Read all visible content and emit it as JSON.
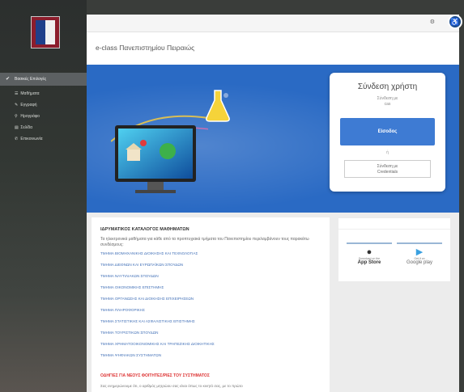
{
  "sidebar": {
    "header": "Βασικές Επιλογές",
    "items": [
      {
        "label": "Μαθήματα",
        "icon": "list-icon"
      },
      {
        "label": "Εγγραφή",
        "icon": "edit-icon"
      },
      {
        "label": "Ηρογράφο",
        "icon": "search-icon"
      },
      {
        "label": "Σελίδα",
        "icon": "table-icon"
      },
      {
        "label": "Επικοινωνία",
        "icon": "phone-icon"
      }
    ]
  },
  "header": {
    "site_title": "e-class Πανεπιστημίου Πειραιώς",
    "settings_icon": "gear-icon",
    "accessibility_icon": "accessibility-icon"
  },
  "login": {
    "title": "Σύνδεση χρήστη",
    "via_line1": "Σύνδεση με",
    "via_line2": "cas",
    "button": "Είσοδος",
    "or": "ή",
    "cred_line1": "Σύνδεση με",
    "cred_line2": "Credentials"
  },
  "catalog": {
    "heading": "ΙΔΡΥΜΑΤΙΚΟΣ ΚΑΤΑΛΟΓΟΣ ΜΑΘΗΜΑΤΩΝ",
    "intro": "Τα ηλεκτρονικά μαθήματα για κάθε από τα προπτυχιακά τμήματα του Πανεπιστημίου περιλαμβάνουν τους παρακάτω συνδέσμους:",
    "departments": [
      "ΤΜΗΜΑ ΒΙΟΜΗΧΑΝΙΚΗΣ ΔΙΟΙΚΗΣΗΣ ΚΑΙ ΤΕΧΝΟΛΟΓΙΑΣ",
      "ΤΜΗΜΑ ΔΙΕΘΝΩΝ ΚΑΙ ΕΥΡΩΠΑΪΚΩΝ ΣΠΟΥΔΩΝ",
      "ΤΜΗΜΑ ΝΑΥΤΙΛΙΑΚΩΝ ΣΠΟΥΔΩΝ",
      "ΤΜΗΜΑ ΟΙΚΟΝΟΜΙΚΗΣ ΕΠΙΣΤΗΜΗΣ",
      "ΤΜΗΜΑ ΟΡΓΑΝΩΣΗΣ ΚΑΙ ΔΙΟΙΚΗΣΗΣ ΕΠΙΧΕΙΡΗΣΕΩΝ",
      "ΤΜΗΜΑ ΠΛΗΡΟΦΟΡΙΚΗΣ",
      "ΤΜΗΜΑ ΣΤΑΤΙΣΤΙΚΗΣ ΚΑΙ ΑΣΦΑΛΙΣΤΙΚΗΣ ΕΠΙΣΤΗΜΗΣ",
      "ΤΜΗΜΑ ΤΟΥΡΙΣΤΙΚΩΝ ΣΠΟΥΔΩΝ",
      "ΤΜΗΜΑ ΧΡΗΜΑΤΟΟΙΚΟΝΟΜΙΚΗΣ ΚΑΙ ΤΡΑΠΕΖΙΚΗΣ ΔΙΟΙΚΗΤΙΚΗΣ",
      "ΤΜΗΜΑ ΨΗΦΙΑΚΩΝ ΣΥΣΤΗΜΑΤΩΝ"
    ],
    "guide": "ΟΔΗΓΙΕΣ ΓΙΑ ΝΕΟΥΣ ΦΟΙΤΗΤΕΣ/ΡΙΕΣ ΤΟΥ ΣΥΣΤΗΜΑΤΟΣ",
    "guide_text": "Σας ενημερώνουμε ότι, ο αριθμός μητρώου σας είναι όπως το κινητό σας, με το πρώτο"
  },
  "apps": {
    "appstore_small": "Download on the",
    "appstore": "App Store",
    "googleplay_small": "Get it on",
    "googleplay": "Google play"
  },
  "colors": {
    "accent": "#3e7bd3",
    "hero": "#2a6ac4",
    "link": "#4472b8",
    "alert": "#dd3333"
  }
}
